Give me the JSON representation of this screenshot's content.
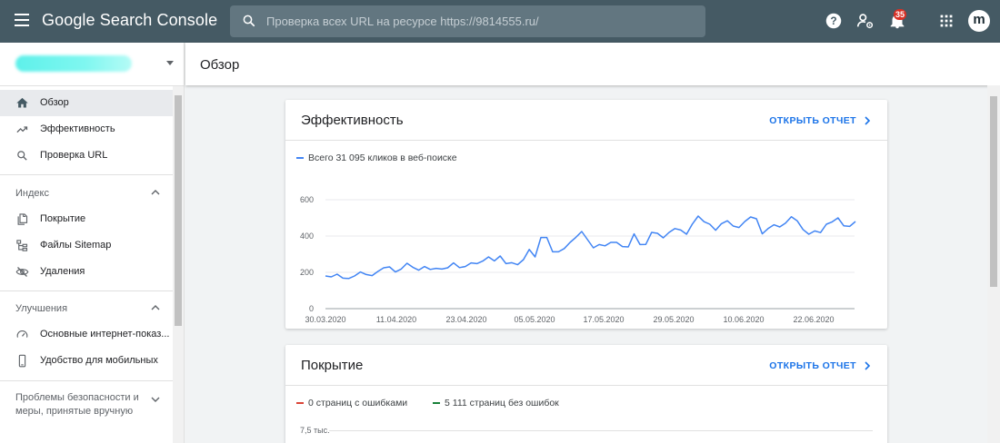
{
  "app": {
    "title": "Google Search Console"
  },
  "search": {
    "placeholder": "Проверка всех URL на ресурсе https://9814555.ru/"
  },
  "topbar": {
    "notifications_count": "35",
    "avatar_letter": "m"
  },
  "header": {
    "title": "Обзор"
  },
  "sidebar": {
    "items": [
      {
        "label": "Обзор",
        "icon": "home-icon",
        "active": true
      },
      {
        "label": "Эффективность",
        "icon": "trending-up-icon"
      },
      {
        "label": "Проверка URL",
        "icon": "search-icon"
      }
    ],
    "sections": [
      {
        "title": "Индекс",
        "items": [
          {
            "label": "Покрытие",
            "icon": "file-copy-icon"
          },
          {
            "label": "Файлы Sitemap",
            "icon": "sitemap-icon"
          },
          {
            "label": "Удаления",
            "icon": "visibility-off-icon"
          }
        ]
      },
      {
        "title": "Улучшения",
        "items": [
          {
            "label": "Основные интернет-показ...",
            "icon": "speed-icon"
          },
          {
            "label": "Удобство для мобильных",
            "icon": "smartphone-icon"
          }
        ]
      },
      {
        "title": "Проблемы безопасности и меры, принятые вручную"
      }
    ]
  },
  "performance_card": {
    "title": "Эффективность",
    "link": "ОТКРЫТЬ ОТЧЕТ",
    "legend": "Всего 31 095 кликов в веб-поиске",
    "series_color": "#4285f4"
  },
  "coverage_card": {
    "title": "Покрытие",
    "link": "ОТКРЫТЬ ОТЧЕТ",
    "legend_errors": "0 страниц с ошибками",
    "legend_valid": "5 111 страниц без ошибок",
    "error_color": "#db4437",
    "valid_color": "#188038",
    "y_top_label": "7,5 тыс."
  },
  "chart_data": {
    "type": "line",
    "yticks": [
      "0",
      "200",
      "400",
      "600"
    ],
    "ylim": [
      0,
      600
    ],
    "xtick_labels": [
      "30.03.2020",
      "11.04.2020",
      "23.04.2020",
      "05.05.2020",
      "17.05.2020",
      "29.05.2020",
      "10.06.2020",
      "22.06.2020"
    ],
    "series": [
      {
        "values": [
          180,
          175,
          190,
          168,
          166,
          180,
          202,
          188,
          182,
          205,
          225,
          230,
          202,
          218,
          250,
          228,
          212,
          232,
          216,
          222,
          218,
          225,
          252,
          226,
          232,
          252,
          248,
          262,
          285,
          263,
          290,
          248,
          253,
          242,
          270,
          326,
          285,
          392,
          392,
          313,
          313,
          331,
          365,
          393,
          425,
          380,
          335,
          353,
          346,
          365,
          365,
          342,
          340,
          412,
          353,
          354,
          420,
          415,
          390,
          420,
          441,
          433,
          410,
          466,
          510,
          479,
          465,
          432,
          468,
          484,
          455,
          447,
          480,
          505,
          495,
          412,
          441,
          462,
          450,
          471,
          506,
          484,
          436,
          410,
          428,
          419,
          465,
          478,
          500,
          456,
          453,
          480
        ]
      }
    ]
  }
}
